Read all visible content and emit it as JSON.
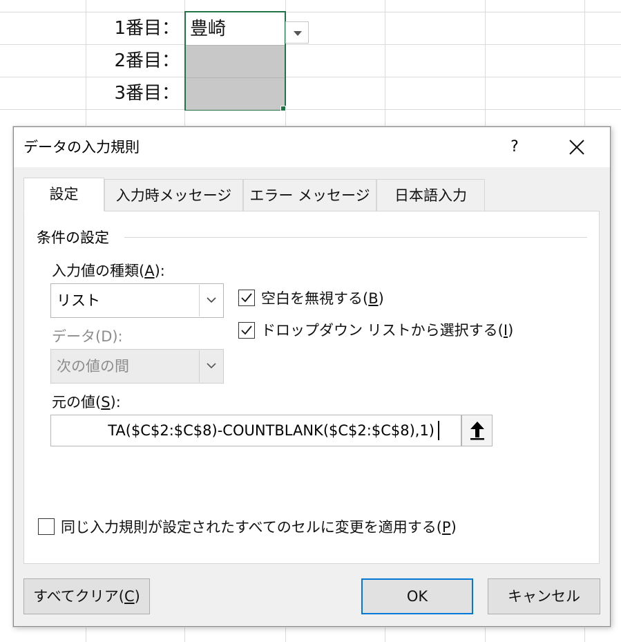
{
  "sheet": {
    "row_labels": [
      "1番目：",
      "2番目：",
      "3番目："
    ],
    "selected_value": "豊崎"
  },
  "dialog": {
    "title": "データの入力規則",
    "help_label": "?",
    "tabs": [
      "設定",
      "入力時メッセージ",
      "エラー メッセージ",
      "日本語入力"
    ],
    "section_title": "条件の設定",
    "allow_label": "入力値の種類(",
    "allow_key": "A",
    "allow_suffix": "):",
    "allow_value": "リスト",
    "data_label": "データ(D):",
    "data_value": "次の値の間",
    "ignore_blank_label": "空白を無視する(",
    "ignore_blank_key": "B",
    "ignore_blank_suffix": ")",
    "ignore_blank_checked": true,
    "in_cell_dropdown_label": "ドロップダウン リストから選択する(",
    "in_cell_dropdown_key": "I",
    "in_cell_dropdown_suffix": ")",
    "in_cell_dropdown_checked": true,
    "source_label": "元の値(",
    "source_key": "S",
    "source_suffix": "):",
    "source_value": "TA($C$2:$C$8)-COUNTBLANK($C$2:$C$8),1)",
    "apply_all_label": "同じ入力規則が設定されたすべてのセルに変更を適用する(",
    "apply_all_key": "P",
    "apply_all_suffix": ")",
    "apply_all_checked": false,
    "clear_all_label": "すべてクリア(",
    "clear_all_key": "C",
    "clear_all_suffix": ")",
    "ok_label": "OK",
    "cancel_label": "キャンセル"
  },
  "colors": {
    "selection_border": "#217346",
    "default_button_border": "#0078d7"
  }
}
